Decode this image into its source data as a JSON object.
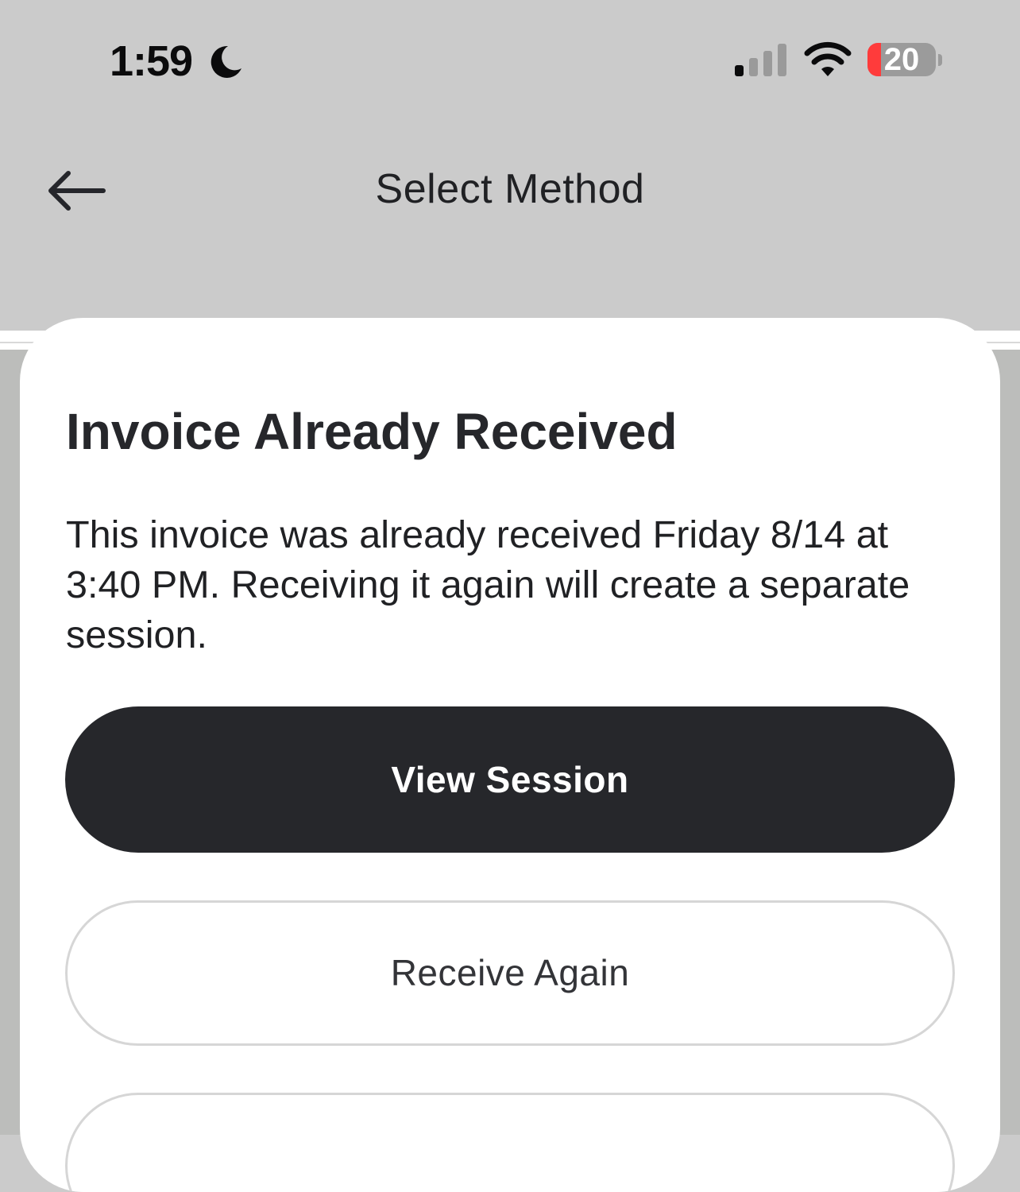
{
  "status_bar": {
    "time": "1:59",
    "battery_level": "20",
    "battery_fraction": 0.2,
    "icons": [
      "moon-icon",
      "signal-icon",
      "wifi-icon",
      "battery-icon"
    ]
  },
  "nav": {
    "title": "Select Method",
    "back_icon": "arrow-left-icon"
  },
  "dialog": {
    "title": "Invoice Already Received",
    "message": "This invoice was already received Friday 8/14 at 3:40 PM. Receiving it again will create a separate session.",
    "primary_button": "View Session",
    "secondary_button": "Receive Again",
    "third_button": ""
  },
  "colors": {
    "nav_background": "#cbcbcb",
    "backdrop": "#bcbdbb",
    "primary_button": "#26272b",
    "battery_low": "#ff3b3b"
  }
}
